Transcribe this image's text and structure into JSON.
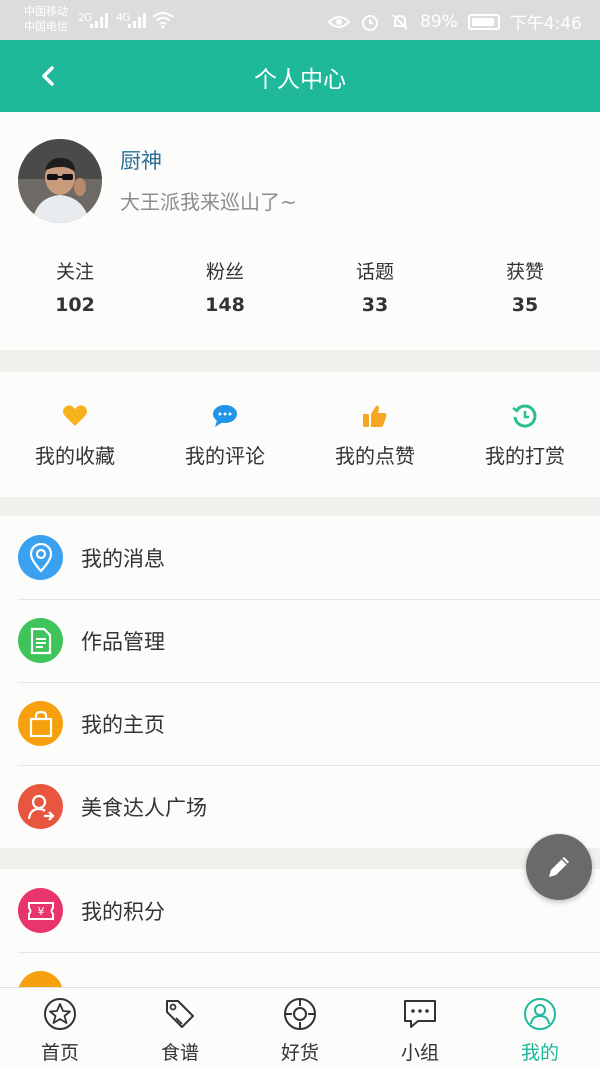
{
  "status_bar": {
    "carrier1": "中国移动",
    "carrier2": "中国电信",
    "signal1": "2G",
    "signal2": "4G",
    "battery": "89%",
    "time": "下午4:46"
  },
  "app_bar": {
    "title": "个人中心",
    "back_icon": "chevron-left-icon"
  },
  "profile": {
    "name": "厨神",
    "bio": "大王派我来巡山了~",
    "stats": [
      {
        "label": "关注",
        "value": "102"
      },
      {
        "label": "粉丝",
        "value": "148"
      },
      {
        "label": "话题",
        "value": "33"
      },
      {
        "label": "获赞",
        "value": "35"
      }
    ]
  },
  "quick_actions": [
    {
      "label": "我的收藏",
      "icon": "heart-icon",
      "color": "#f5b21b"
    },
    {
      "label": "我的评论",
      "icon": "comment-icon",
      "color": "#2196e8"
    },
    {
      "label": "我的点赞",
      "icon": "thumbs-up-icon",
      "color": "#f5a623"
    },
    {
      "label": "我的打赏",
      "icon": "reward-icon",
      "color": "#2bbf8e"
    }
  ],
  "menu_group1": [
    {
      "label": "我的消息",
      "icon": "location-pin-icon",
      "color": "#3aa0f0"
    },
    {
      "label": "作品管理",
      "icon": "document-icon",
      "color": "#3ec45a"
    },
    {
      "label": "我的主页",
      "icon": "shopping-bag-icon",
      "color": "#f5a00c"
    },
    {
      "label": "美食达人广场",
      "icon": "user-share-icon",
      "color": "#e8563f"
    }
  ],
  "menu_group2": [
    {
      "label": "我的积分",
      "icon": "ticket-icon",
      "color": "#e8356b"
    }
  ],
  "tabs": [
    {
      "label": "首页",
      "icon": "star-icon"
    },
    {
      "label": "食谱",
      "icon": "tag-icon"
    },
    {
      "label": "好货",
      "icon": "target-icon"
    },
    {
      "label": "小组",
      "icon": "chat-icon"
    },
    {
      "label": "我的",
      "icon": "user-icon"
    }
  ],
  "colors": {
    "primary": "#1fb89a",
    "username": "#2a6f97",
    "fab": "#6a6a6a"
  }
}
